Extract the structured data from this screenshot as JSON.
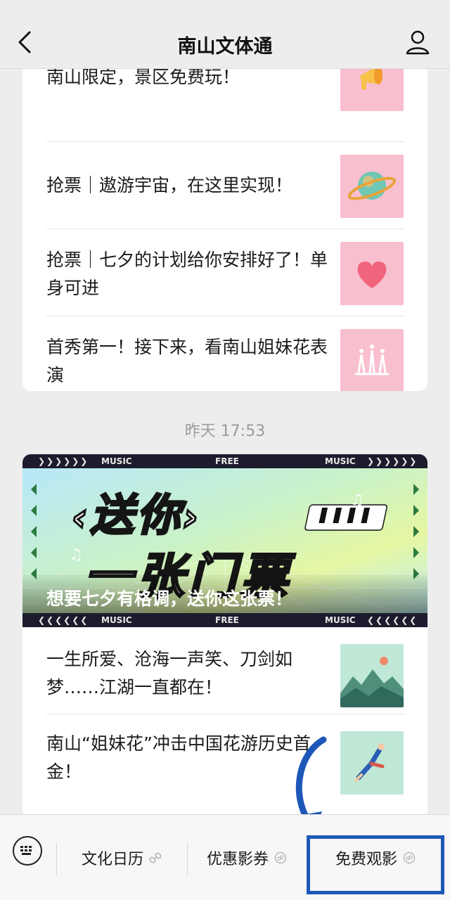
{
  "header": {
    "title": "南山文体通"
  },
  "articles_top": [
    {
      "title": "南山限定，景区免费玩！",
      "thumb": "megaphone-thumb"
    },
    {
      "title": "抢票｜遨游宇宙，在这里实现！",
      "thumb": "planet-thumb"
    },
    {
      "title": "抢票｜七夕的计划给你安排好了！单身可进",
      "thumb": "heart-thumb"
    },
    {
      "title": "首秀第一！接下来，看南山姐妹花表演",
      "thumb": "swimmers-thumb"
    }
  ],
  "timestamp": "昨天 17:53",
  "banner": {
    "caption": "想要七夕有格调，送你这张票！",
    "strip_left": "MUSIC",
    "strip_center": "FREE",
    "strip_right": "MUSIC",
    "art_line1": "送你",
    "art_line2": "一张门票"
  },
  "articles_bottom": [
    {
      "title": "一生所爱、沧海一声笑、刀剑如梦……江湖一直都在！",
      "thumb": "landscape-thumb"
    },
    {
      "title": "南山“姐妹花”冲击中国花游历史首金！",
      "thumb": "diver-thumb"
    }
  ],
  "menu": {
    "items": [
      {
        "label": "文化日历"
      },
      {
        "label": "优惠影券"
      },
      {
        "label": "免费观影"
      }
    ]
  },
  "colors": {
    "background": "#ededed",
    "highlight": "#1d58b8",
    "thumb_pink": "#f8bfcf",
    "thumb_mint": "#bfe8d7"
  }
}
